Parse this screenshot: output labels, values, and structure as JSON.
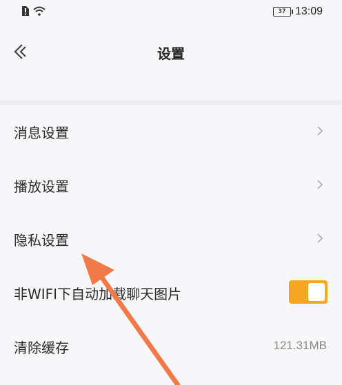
{
  "status_bar": {
    "battery_level": "37",
    "time": "13:09"
  },
  "header": {
    "title": "设置"
  },
  "settings": {
    "items": [
      {
        "label": "消息设置"
      },
      {
        "label": "播放设置"
      },
      {
        "label": "隐私设置"
      },
      {
        "label": "非WIFI下自动加载聊天图片",
        "toggle_on": true
      },
      {
        "label": "清除缓存",
        "value": "121.31MB"
      }
    ]
  },
  "colors": {
    "toggle_on": "#f5a623",
    "annotation_arrow": "#f07a4a"
  }
}
